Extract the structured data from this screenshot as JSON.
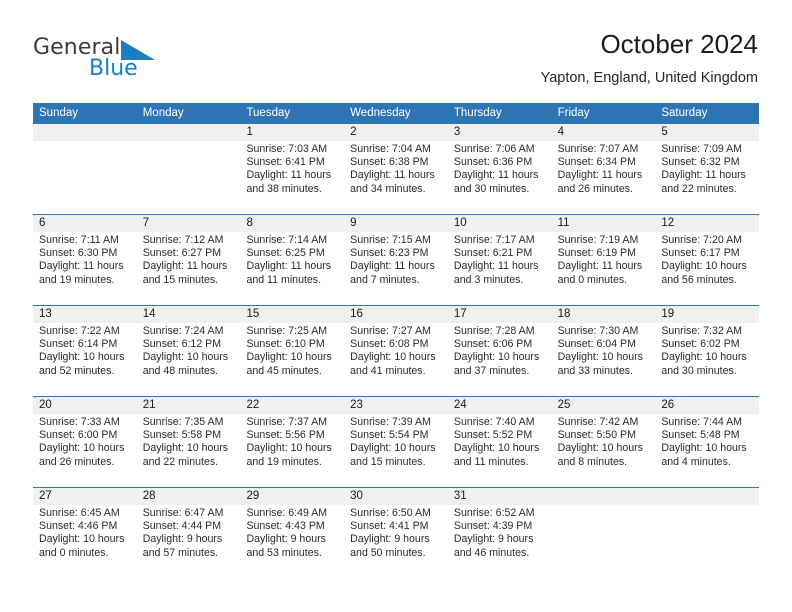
{
  "branding": {
    "name_part1": "General",
    "name_part2": "Blue",
    "flag_icon": "triangle-flag-icon",
    "accent_color": "#1a7fc1"
  },
  "header": {
    "title": "October 2024",
    "subtitle": "Yapton, England, United Kingdom"
  },
  "theme": {
    "header_blue": "#2e75b6",
    "date_band_gray": "#f0f0f0",
    "text_dark": "#1a1a1a"
  },
  "weekday_headers": [
    "Sunday",
    "Monday",
    "Tuesday",
    "Wednesday",
    "Thursday",
    "Friday",
    "Saturday"
  ],
  "weeks": [
    [
      {
        "day": "",
        "empty": true,
        "sunrise": "",
        "sunset": "",
        "daylight_line1": "",
        "daylight_line2": ""
      },
      {
        "day": "",
        "empty": true,
        "sunrise": "",
        "sunset": "",
        "daylight_line1": "",
        "daylight_line2": ""
      },
      {
        "day": "1",
        "sunrise": "Sunrise: 7:03 AM",
        "sunset": "Sunset: 6:41 PM",
        "daylight_line1": "Daylight: 11 hours",
        "daylight_line2": "and 38 minutes."
      },
      {
        "day": "2",
        "sunrise": "Sunrise: 7:04 AM",
        "sunset": "Sunset: 6:38 PM",
        "daylight_line1": "Daylight: 11 hours",
        "daylight_line2": "and 34 minutes."
      },
      {
        "day": "3",
        "sunrise": "Sunrise: 7:06 AM",
        "sunset": "Sunset: 6:36 PM",
        "daylight_line1": "Daylight: 11 hours",
        "daylight_line2": "and 30 minutes."
      },
      {
        "day": "4",
        "sunrise": "Sunrise: 7:07 AM",
        "sunset": "Sunset: 6:34 PM",
        "daylight_line1": "Daylight: 11 hours",
        "daylight_line2": "and 26 minutes."
      },
      {
        "day": "5",
        "sunrise": "Sunrise: 7:09 AM",
        "sunset": "Sunset: 6:32 PM",
        "daylight_line1": "Daylight: 11 hours",
        "daylight_line2": "and 22 minutes."
      }
    ],
    [
      {
        "day": "6",
        "sunrise": "Sunrise: 7:11 AM",
        "sunset": "Sunset: 6:30 PM",
        "daylight_line1": "Daylight: 11 hours",
        "daylight_line2": "and 19 minutes."
      },
      {
        "day": "7",
        "sunrise": "Sunrise: 7:12 AM",
        "sunset": "Sunset: 6:27 PM",
        "daylight_line1": "Daylight: 11 hours",
        "daylight_line2": "and 15 minutes."
      },
      {
        "day": "8",
        "sunrise": "Sunrise: 7:14 AM",
        "sunset": "Sunset: 6:25 PM",
        "daylight_line1": "Daylight: 11 hours",
        "daylight_line2": "and 11 minutes."
      },
      {
        "day": "9",
        "sunrise": "Sunrise: 7:15 AM",
        "sunset": "Sunset: 6:23 PM",
        "daylight_line1": "Daylight: 11 hours",
        "daylight_line2": "and 7 minutes."
      },
      {
        "day": "10",
        "sunrise": "Sunrise: 7:17 AM",
        "sunset": "Sunset: 6:21 PM",
        "daylight_line1": "Daylight: 11 hours",
        "daylight_line2": "and 3 minutes."
      },
      {
        "day": "11",
        "sunrise": "Sunrise: 7:19 AM",
        "sunset": "Sunset: 6:19 PM",
        "daylight_line1": "Daylight: 11 hours",
        "daylight_line2": "and 0 minutes."
      },
      {
        "day": "12",
        "sunrise": "Sunrise: 7:20 AM",
        "sunset": "Sunset: 6:17 PM",
        "daylight_line1": "Daylight: 10 hours",
        "daylight_line2": "and 56 minutes."
      }
    ],
    [
      {
        "day": "13",
        "sunrise": "Sunrise: 7:22 AM",
        "sunset": "Sunset: 6:14 PM",
        "daylight_line1": "Daylight: 10 hours",
        "daylight_line2": "and 52 minutes."
      },
      {
        "day": "14",
        "sunrise": "Sunrise: 7:24 AM",
        "sunset": "Sunset: 6:12 PM",
        "daylight_line1": "Daylight: 10 hours",
        "daylight_line2": "and 48 minutes."
      },
      {
        "day": "15",
        "sunrise": "Sunrise: 7:25 AM",
        "sunset": "Sunset: 6:10 PM",
        "daylight_line1": "Daylight: 10 hours",
        "daylight_line2": "and 45 minutes."
      },
      {
        "day": "16",
        "sunrise": "Sunrise: 7:27 AM",
        "sunset": "Sunset: 6:08 PM",
        "daylight_line1": "Daylight: 10 hours",
        "daylight_line2": "and 41 minutes."
      },
      {
        "day": "17",
        "sunrise": "Sunrise: 7:28 AM",
        "sunset": "Sunset: 6:06 PM",
        "daylight_line1": "Daylight: 10 hours",
        "daylight_line2": "and 37 minutes."
      },
      {
        "day": "18",
        "sunrise": "Sunrise: 7:30 AM",
        "sunset": "Sunset: 6:04 PM",
        "daylight_line1": "Daylight: 10 hours",
        "daylight_line2": "and 33 minutes."
      },
      {
        "day": "19",
        "sunrise": "Sunrise: 7:32 AM",
        "sunset": "Sunset: 6:02 PM",
        "daylight_line1": "Daylight: 10 hours",
        "daylight_line2": "and 30 minutes."
      }
    ],
    [
      {
        "day": "20",
        "sunrise": "Sunrise: 7:33 AM",
        "sunset": "Sunset: 6:00 PM",
        "daylight_line1": "Daylight: 10 hours",
        "daylight_line2": "and 26 minutes."
      },
      {
        "day": "21",
        "sunrise": "Sunrise: 7:35 AM",
        "sunset": "Sunset: 5:58 PM",
        "daylight_line1": "Daylight: 10 hours",
        "daylight_line2": "and 22 minutes."
      },
      {
        "day": "22",
        "sunrise": "Sunrise: 7:37 AM",
        "sunset": "Sunset: 5:56 PM",
        "daylight_line1": "Daylight: 10 hours",
        "daylight_line2": "and 19 minutes."
      },
      {
        "day": "23",
        "sunrise": "Sunrise: 7:39 AM",
        "sunset": "Sunset: 5:54 PM",
        "daylight_line1": "Daylight: 10 hours",
        "daylight_line2": "and 15 minutes."
      },
      {
        "day": "24",
        "sunrise": "Sunrise: 7:40 AM",
        "sunset": "Sunset: 5:52 PM",
        "daylight_line1": "Daylight: 10 hours",
        "daylight_line2": "and 11 minutes."
      },
      {
        "day": "25",
        "sunrise": "Sunrise: 7:42 AM",
        "sunset": "Sunset: 5:50 PM",
        "daylight_line1": "Daylight: 10 hours",
        "daylight_line2": "and 8 minutes."
      },
      {
        "day": "26",
        "sunrise": "Sunrise: 7:44 AM",
        "sunset": "Sunset: 5:48 PM",
        "daylight_line1": "Daylight: 10 hours",
        "daylight_line2": "and 4 minutes."
      }
    ],
    [
      {
        "day": "27",
        "sunrise": "Sunrise: 6:45 AM",
        "sunset": "Sunset: 4:46 PM",
        "daylight_line1": "Daylight: 10 hours",
        "daylight_line2": "and 0 minutes."
      },
      {
        "day": "28",
        "sunrise": "Sunrise: 6:47 AM",
        "sunset": "Sunset: 4:44 PM",
        "daylight_line1": "Daylight: 9 hours",
        "daylight_line2": "and 57 minutes."
      },
      {
        "day": "29",
        "sunrise": "Sunrise: 6:49 AM",
        "sunset": "Sunset: 4:43 PM",
        "daylight_line1": "Daylight: 9 hours",
        "daylight_line2": "and 53 minutes."
      },
      {
        "day": "30",
        "sunrise": "Sunrise: 6:50 AM",
        "sunset": "Sunset: 4:41 PM",
        "daylight_line1": "Daylight: 9 hours",
        "daylight_line2": "and 50 minutes."
      },
      {
        "day": "31",
        "sunrise": "Sunrise: 6:52 AM",
        "sunset": "Sunset: 4:39 PM",
        "daylight_line1": "Daylight: 9 hours",
        "daylight_line2": "and 46 minutes."
      },
      {
        "day": "",
        "empty": true,
        "sunrise": "",
        "sunset": "",
        "daylight_line1": "",
        "daylight_line2": ""
      },
      {
        "day": "",
        "empty": true,
        "sunrise": "",
        "sunset": "",
        "daylight_line1": "",
        "daylight_line2": ""
      }
    ]
  ]
}
